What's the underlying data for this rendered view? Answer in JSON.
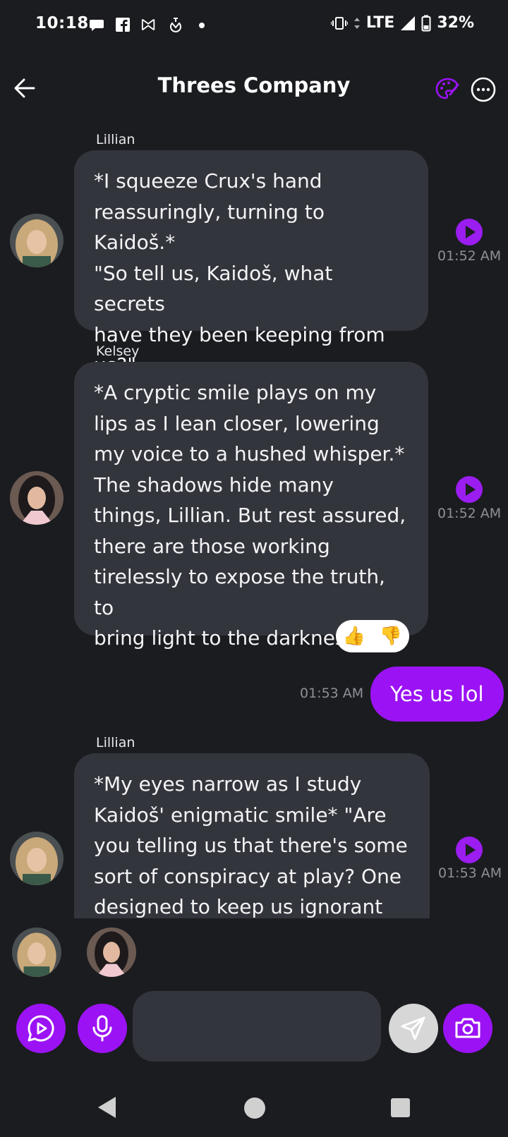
{
  "status_bar": {
    "time": "10:18",
    "network": "LTE",
    "battery": "32%",
    "icons": [
      "chat-bubble-icon",
      "facebook-icon",
      "bowtie-icon",
      "flame-icon",
      "dot-icon",
      "vibrate-icon",
      "signal-icon",
      "battery-icon"
    ]
  },
  "header": {
    "title": "Threes Company",
    "back_icon": "arrow-left-icon",
    "palette_icon": "palette-icon",
    "more_icon": "more-horizontal-icon"
  },
  "messages": [
    {
      "sender": "Lillian",
      "text": "*I squeeze Crux's hand reassuringly, turning to Kaidoš.* \"So tell us, Kaidoš, what secrets have they been keeping from us?\"",
      "lines": [
        "*I squeeze Crux's hand",
        "reassuringly, turning to Kaidoš.*",
        "\"So tell us, Kaidoš, what secrets",
        "have they been keeping from",
        "us?\""
      ],
      "time": "01:52 AM"
    },
    {
      "sender": "Kelsey",
      "text": "*A cryptic smile plays on my lips as I lean closer, lowering my voice to a hushed whisper.* The shadows hide many things, Lillian. But rest assured, there are those working tirelessly to expose the truth, to bring light to the darkness.",
      "lines": [
        "*A cryptic smile plays on my",
        "lips as I lean closer, lowering",
        "my voice to a hushed whisper.*",
        "The shadows hide many",
        "things, Lillian. But rest assured,",
        "there are those working",
        "tirelessly to expose the truth, to",
        "bring light to the darkness."
      ],
      "time": "01:52 AM",
      "reactions": [
        "👍",
        "👎"
      ]
    },
    {
      "sender": "You",
      "text": "Yes us lol",
      "time": "01:53 AM"
    },
    {
      "sender": "Lillian",
      "text": "*My eyes narrow as I study Kaidoš' enigmatic smile* \"Are you telling us that there's some sort of conspiracy at play? One designed to keep us ignorant",
      "lines": [
        "*My eyes narrow as I study",
        "Kaidoš' enigmatic smile* \"Are",
        "you telling us that there's some",
        "sort of conspiracy at play? One",
        "designed to keep us ignorant"
      ],
      "time": "01:53 AM"
    }
  ],
  "composer": {
    "placeholder": "",
    "buttons": [
      "play-chat-icon",
      "microphone-icon",
      "send-icon",
      "camera-icon"
    ]
  },
  "colors": {
    "background": "#1b1c20",
    "bubble": "#33353c",
    "accent": "#9b13f5",
    "timestamp": "#8e9098"
  }
}
